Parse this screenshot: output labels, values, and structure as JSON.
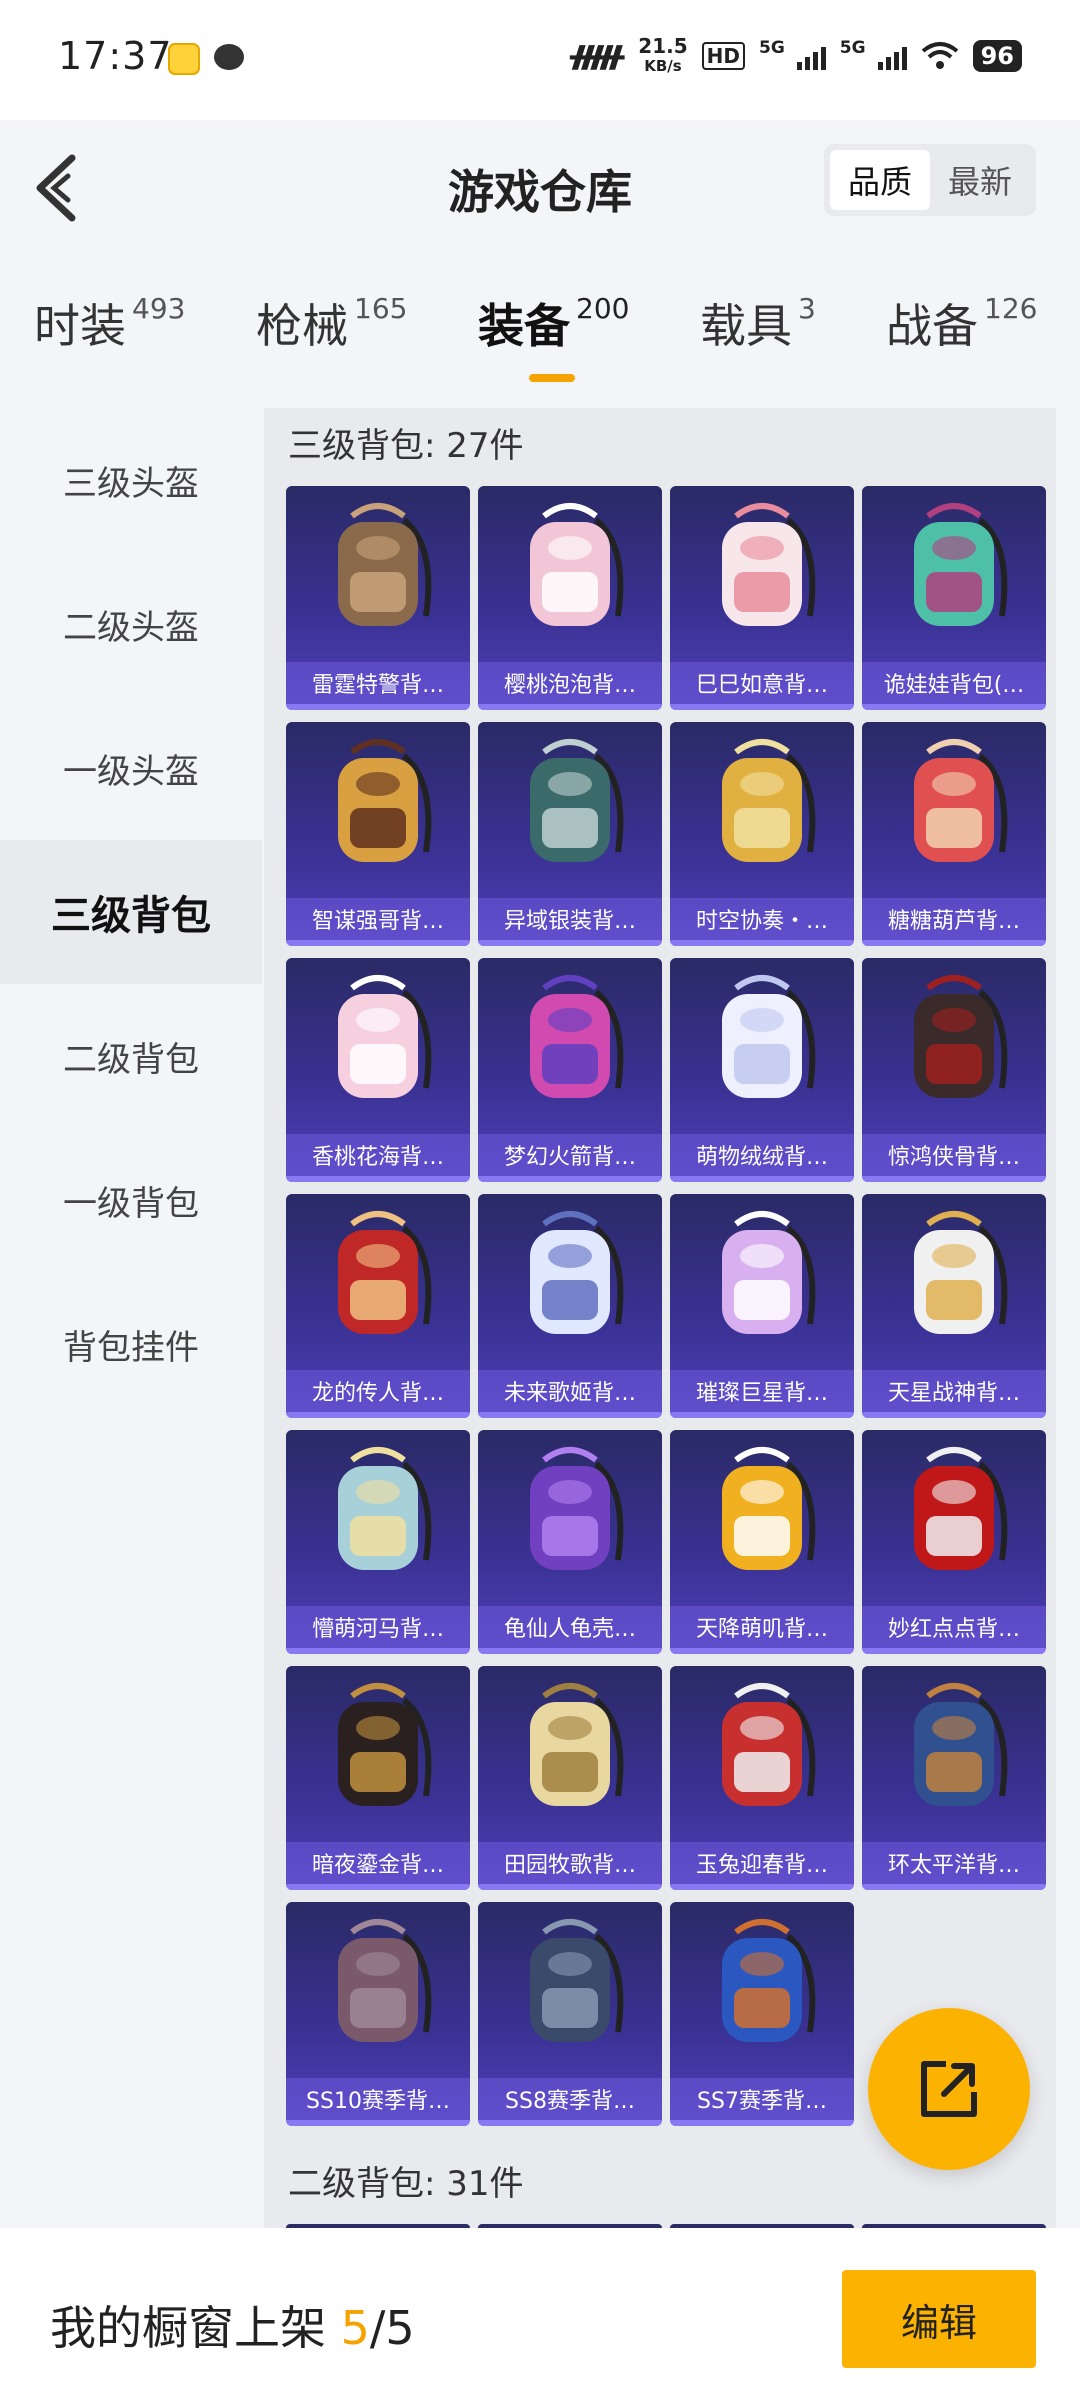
{
  "status_bar": {
    "time": "17:37",
    "net_speed_value": "21.5",
    "net_speed_unit": "KB/s",
    "hd_label": "HD",
    "signal1_label": "5G",
    "signal2_label": "5G",
    "battery": "96"
  },
  "header": {
    "title": "游戏仓库",
    "sort_options": [
      "品质",
      "最新"
    ],
    "active_sort": "品质"
  },
  "tabs": [
    {
      "label": "时装",
      "count": "493"
    },
    {
      "label": "枪械",
      "count": "165"
    },
    {
      "label": "装备",
      "count": "200",
      "active": true
    },
    {
      "label": "载具",
      "count": "3"
    },
    {
      "label": "战备",
      "count": "126"
    }
  ],
  "sidebar": {
    "items": [
      "三级头盔",
      "二级头盔",
      "一级头盔",
      "三级背包",
      "二级背包",
      "一级背包",
      "背包挂件"
    ],
    "active": "三级背包"
  },
  "sections": [
    {
      "title": "三级背包: 27件",
      "items": [
        "雷霆特警背…",
        "樱桃泡泡背…",
        "巳巳如意背…",
        "诡娃娃背包(…",
        "智谋强哥背…",
        "异域银装背…",
        "时空协奏・…",
        "糖糖葫芦背…",
        "香桃花海背…",
        "梦幻火箭背…",
        "萌物绒绒背…",
        "惊鸿侠骨背…",
        "龙的传人背…",
        "未来歌姬背…",
        "璀璨巨星背…",
        "天星战神背…",
        "懵萌河马背…",
        "龟仙人龟壳…",
        "天降萌叽背…",
        "妙红点点背…",
        "暗夜鎏金背…",
        "田园牧歌背…",
        "玉兔迎春背…",
        "环太平洋背…",
        "SS10赛季背…",
        "SS8赛季背…",
        "SS7赛季背…"
      ]
    },
    {
      "title": "二级背包: 31件",
      "items": []
    }
  ],
  "bottom_bar": {
    "showcase_label": "我的橱窗上架",
    "showcase_current": "5",
    "showcase_sep": "/",
    "showcase_total": "5",
    "edit_label": "编辑"
  },
  "colors": {
    "accent": "#fcb200",
    "tile_top": "#2a2a66",
    "tile_bottom": "#5140b8"
  }
}
